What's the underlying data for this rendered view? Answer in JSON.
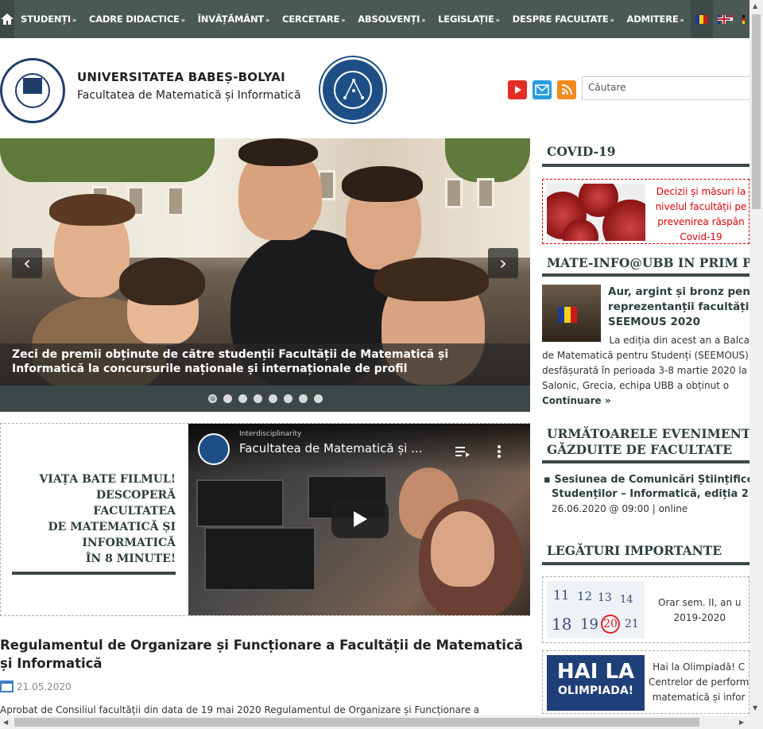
{
  "nav": {
    "items": [
      {
        "label": "STUDENȚI"
      },
      {
        "label": "CADRE DIDACTICE"
      },
      {
        "label": "ÎNVĂȚĂMÂNT"
      },
      {
        "label": "CERCETARE"
      },
      {
        "label": "ABSOLVENȚI"
      },
      {
        "label": "LEGISLAȚIE"
      },
      {
        "label": "DESPRE FACULTATE"
      },
      {
        "label": "ADMITERE"
      }
    ],
    "arrow": "»"
  },
  "header": {
    "university": "UNIVERSITATEA BABEȘ-BOLYAI",
    "faculty": "Facultatea de Matematică și Informatică",
    "search_placeholder": "Căutare"
  },
  "slider": {
    "caption": "Zeci de premii obținute de către studenții Facultății de Matematică și Informatică la concursurile naționale și internaționale de profil",
    "dots": 8,
    "active_dot": 0,
    "prev": "‹",
    "next": "›"
  },
  "video_block": {
    "lines": [
      "VIAȚA BATE FILMUL!",
      "DESCOPERĂ",
      "FACULTATEA",
      "DE MATEMATICĂ ȘI",
      "INFORMATICĂ",
      "ÎN 8 MINUTE!"
    ],
    "video_channel": "Interdisciplinarity",
    "video_title": "Facultatea de Matematică și ..."
  },
  "article": {
    "title": "Regulamentul de Organizare și Funcționare a Facultății de Matematică și Informatică",
    "date": "21.05.2020",
    "excerpt": "Aprobat de Consiliul facultății din data de 19 mai 2020 Regulamentul de Organizare și Funcționare a"
  },
  "sidebar": {
    "covid_heading": "COVID-19",
    "covid_lines": [
      "Decizii și măsuri la",
      "nivelul facultății pe",
      "prevenirea răspân",
      "Covid-19"
    ],
    "news_heading": "MATE-INFO@UBB IN PRIM PL",
    "news_title_lines": [
      "Aur, argint și bronz pent",
      "reprezentanții facultății",
      "SEEMOUS 2020"
    ],
    "news_text_lines": [
      "La ediția din acest an a Balca",
      "de Matematică pentru Studenți (SEEMOUS)",
      "desfășurată în perioada 3-8 martie 2020 la",
      "Salonic, Grecia, echipa UBB a obținut o"
    ],
    "news_more": "Continuare »",
    "events_heading_lines": [
      "URMĂTOARELE EVENIMENTE",
      "GĂZDUITE DE FACULTATE"
    ],
    "event_title_lines": [
      "▪ Sesiunea de Comunicări Științifice",
      "Studenților – Informatică, ediția 2"
    ],
    "event_date": "26.06.2020 @ 09:00 | online",
    "links_heading": "LEGĂTURI IMPORTANTE",
    "link1_lines": [
      "Orar sem. II, an u",
      "2019-2020"
    ],
    "link2_lines": [
      "Hai la Olimpiadă! C",
      "Centrelor de perform",
      "matematică și infor"
    ],
    "hai_lines": [
      "HAI LA",
      "OLIMPIADA!"
    ],
    "cal_numbers": [
      "11",
      "12",
      "13",
      "14",
      "18",
      "19",
      "20",
      "21"
    ]
  },
  "colors": {
    "nav_bg": "#4a5856",
    "accent_dark": "#3c4748",
    "heading": "#2c3f3e",
    "covid_red": "#dd0000",
    "brand_blue": "#1d4f86"
  }
}
